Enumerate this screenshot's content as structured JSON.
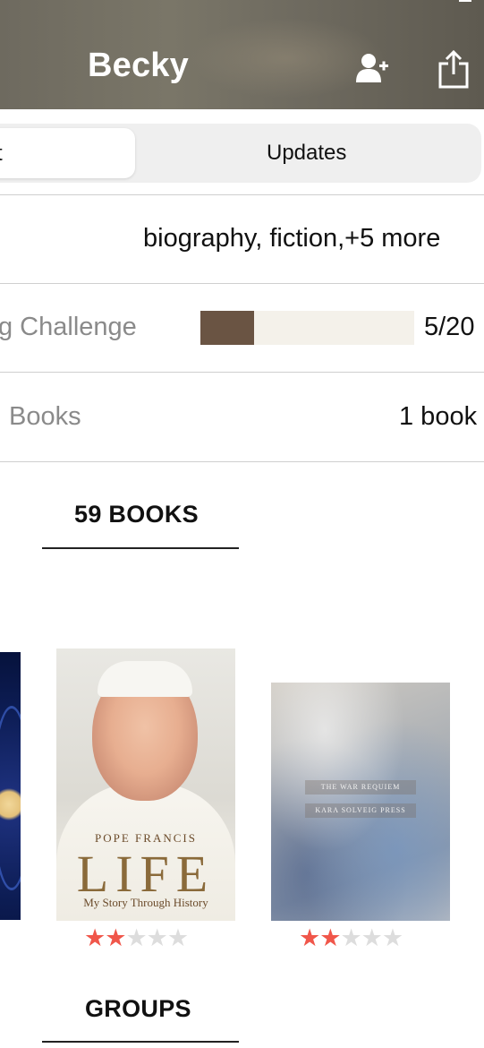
{
  "header": {
    "title": "Becky",
    "icons": {
      "add_friend": "add-friend-icon",
      "share": "share-icon"
    }
  },
  "tabs": {
    "active_label": "t",
    "updates_label": "Updates"
  },
  "rows": {
    "genres_value": "biography, fiction,+5 more",
    "challenge_label": "g Challenge",
    "challenge_count": "5/20",
    "challenge_progress": 0.25,
    "books_label": "Books",
    "books_value": "1 book"
  },
  "sections": {
    "books_heading": "59 BOOKS",
    "groups_heading": "GROUPS"
  },
  "books": [
    {
      "cover": "partial-blue-cover",
      "rating": null
    },
    {
      "cover_author": "POPE FRANCIS",
      "cover_title": "LIFE",
      "cover_subtitle": "My Story Through History",
      "rating": 2,
      "max_rating": 5
    },
    {
      "cover_title": "THE WAR REQUIEM",
      "cover_publisher": "KARA SOLVEIG PRESS",
      "rating": 2,
      "max_rating": 5
    }
  ],
  "colors": {
    "progress_fill": "#6a5443",
    "progress_track": "#f4f1ea",
    "star_filled": "#f0564a",
    "star_empty": "#dddddd"
  }
}
